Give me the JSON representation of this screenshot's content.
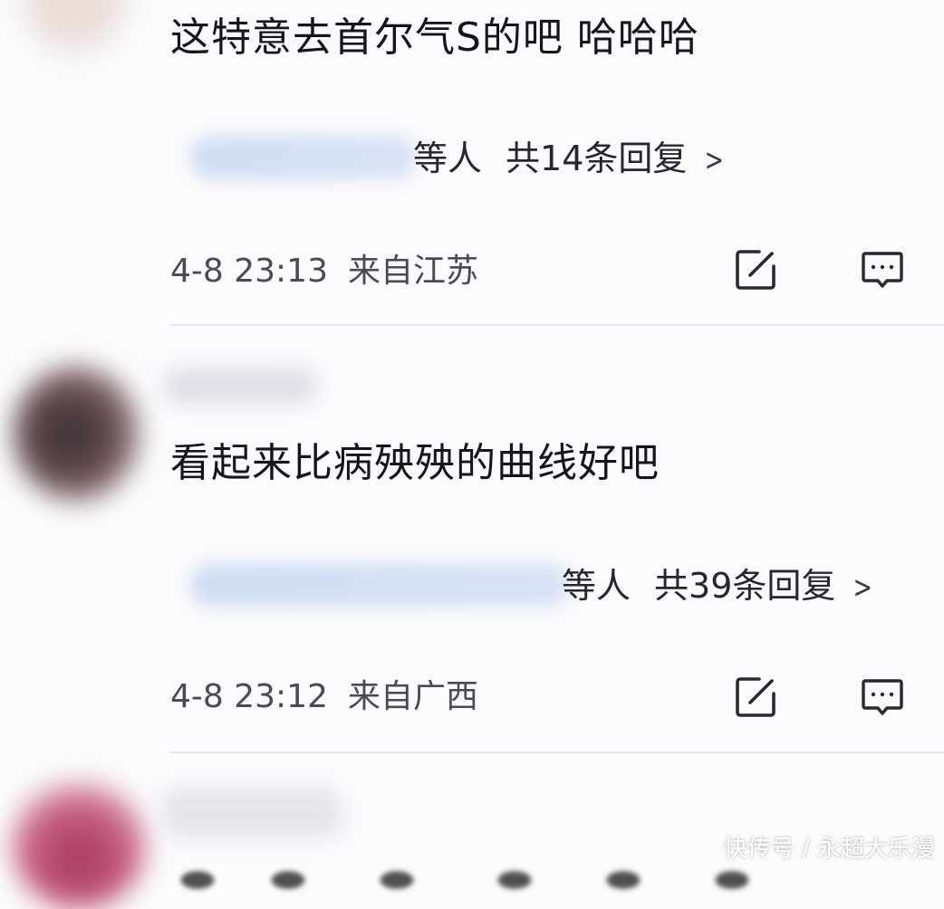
{
  "comments": [
    {
      "text": "这特意去首尔气S的吧 哈哈哈",
      "reply_summary": {
        "suffix": "等人",
        "count_text": "共14条回复",
        "chevron": ">"
      },
      "time": "4-8 23:13",
      "location": "来自江苏",
      "actions": {
        "edit_icon": "edit-icon",
        "reply_icon": "comment-icon"
      }
    },
    {
      "text": "看起来比病殃殃的曲线好吧",
      "reply_summary": {
        "suffix": "等人",
        "count_text": "共39条回复",
        "chevron": ">"
      },
      "time": "4-8 23:12",
      "location": "来自广西",
      "actions": {
        "edit_icon": "edit-icon",
        "reply_icon": "comment-icon"
      }
    }
  ],
  "watermark": "快传号 / 永超大乐漫",
  "colors": {
    "background": "#fbfbfd",
    "text": "#16161a",
    "meta": "#4a4a4f",
    "divider": "#e6e6ea"
  }
}
